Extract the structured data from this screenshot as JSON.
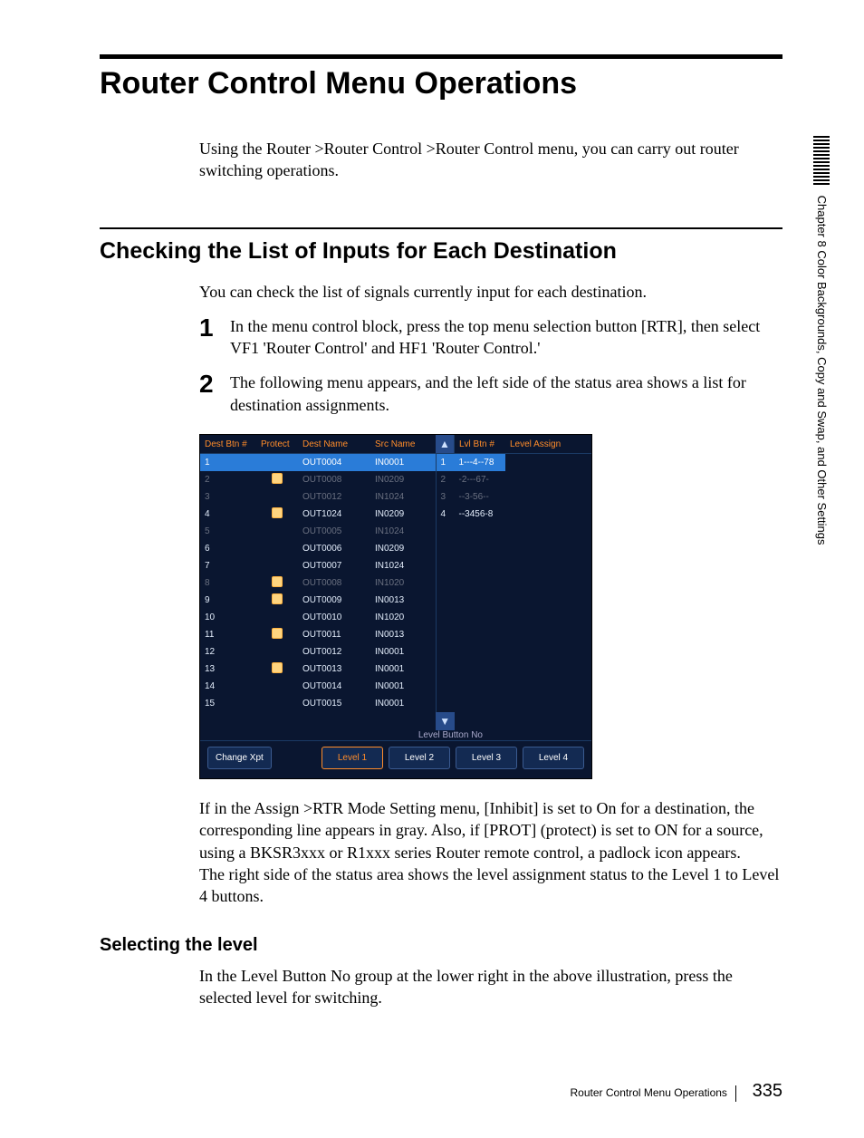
{
  "sidebar": {
    "chapter": "Chapter 8   Color Backgrounds, Copy and Swap, and Other Settings"
  },
  "title": "Router Control Menu Operations",
  "intro": "Using the Router >Router Control >Router Control menu, you can carry out router switching operations.",
  "section1": {
    "heading": "Checking the List of Inputs for Each Destination",
    "intro": "You can check the list of signals currently input for each destination.",
    "steps": [
      {
        "num": "1",
        "text": "In the menu control block, press the top menu selection button [RTR], then select VF1 'Router Control' and HF1 'Router Control.'"
      },
      {
        "num": "2",
        "text": "The following menu appears, and the left side of the status area shows a list for destination assignments."
      }
    ]
  },
  "screenshot": {
    "left_headers": {
      "c1": "Dest Btn #",
      "c2": "Protect",
      "c3": "Dest Name",
      "c4": "Src Name"
    },
    "rows": [
      {
        "n": "1",
        "p": "",
        "d": "OUT0004",
        "s": "IN0001",
        "state": "selected"
      },
      {
        "n": "2",
        "p": "lock",
        "d": "OUT0008",
        "s": "IN0209",
        "state": "grayed"
      },
      {
        "n": "3",
        "p": "",
        "d": "OUT0012",
        "s": "IN1024",
        "state": "grayed"
      },
      {
        "n": "4",
        "p": "lock",
        "d": "OUT1024",
        "s": "IN0209",
        "state": "normal"
      },
      {
        "n": "5",
        "p": "",
        "d": "OUT0005",
        "s": "IN1024",
        "state": "grayed"
      },
      {
        "n": "6",
        "p": "",
        "d": "OUT0006",
        "s": "IN0209",
        "state": "normal"
      },
      {
        "n": "7",
        "p": "",
        "d": "OUT0007",
        "s": "IN1024",
        "state": "normal"
      },
      {
        "n": "8",
        "p": "lock",
        "d": "OUT0008",
        "s": "IN1020",
        "state": "grayed"
      },
      {
        "n": "9",
        "p": "lock",
        "d": "OUT0009",
        "s": "IN0013",
        "state": "normal"
      },
      {
        "n": "10",
        "p": "",
        "d": "OUT0010",
        "s": "IN1020",
        "state": "normal"
      },
      {
        "n": "11",
        "p": "lock",
        "d": "OUT0011",
        "s": "IN0013",
        "state": "normal"
      },
      {
        "n": "12",
        "p": "",
        "d": "OUT0012",
        "s": "IN0001",
        "state": "normal"
      },
      {
        "n": "13",
        "p": "lock",
        "d": "OUT0013",
        "s": "IN0001",
        "state": "normal"
      },
      {
        "n": "14",
        "p": "",
        "d": "OUT0014",
        "s": "IN0001",
        "state": "normal"
      },
      {
        "n": "15",
        "p": "",
        "d": "OUT0015",
        "s": "IN0001",
        "state": "normal"
      }
    ],
    "right_headers": {
      "c1": "Lvl Btn #",
      "c2": "Level Assign"
    },
    "right_rows": [
      {
        "n": "1",
        "a": "1---4--78",
        "state": "selected"
      },
      {
        "n": "2",
        "a": "-2---67-",
        "state": "normal"
      },
      {
        "n": "3",
        "a": "--3-56--",
        "state": "normal"
      },
      {
        "n": "4",
        "a": "--3456-8",
        "state": "normal"
      }
    ],
    "group_label": "Level Button No",
    "bottom_buttons": {
      "change": "Change Xpt",
      "l1": "Level 1",
      "l2": "Level 2",
      "l3": "Level 3",
      "l4": "Level 4"
    }
  },
  "para_after_ss": "If in the Assign >RTR Mode Setting menu, [Inhibit] is set to On for a destination, the corresponding line appears in gray. Also, if [PROT] (protect) is set to ON for a source, using a BKSR3xxx or R1xxx series Router remote control, a padlock icon appears.",
  "para_after_ss_2": "The right side of the status area shows the level assignment status to the Level 1 to Level 4 buttons.",
  "section2": {
    "heading": "Selecting the level",
    "text": "In the Level Button No group at the lower right in the above illustration, press the selected level for switching."
  },
  "footer": {
    "text": "Router Control Menu Operations",
    "page": "335"
  }
}
